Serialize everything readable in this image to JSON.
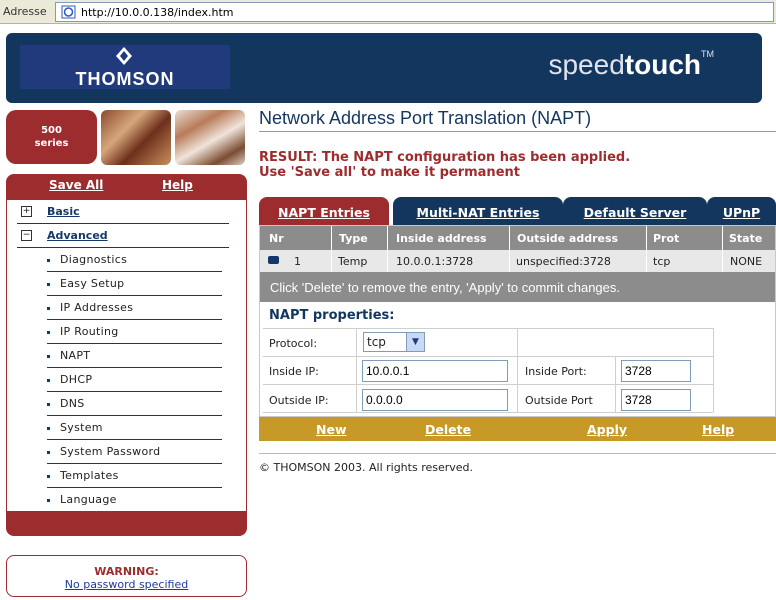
{
  "browser": {
    "address_label": "Adresse",
    "url": "http://10.0.0.138/index.htm"
  },
  "header": {
    "logo_text": "THOMSON",
    "brand_light": "speed",
    "brand_bold": "touch",
    "brand_tm": "TM"
  },
  "series": {
    "number": "500",
    "label": "series"
  },
  "sidebar": {
    "save_all": "Save All",
    "help": "Help",
    "groups": [
      {
        "label": "Basic",
        "state": "+"
      },
      {
        "label": "Advanced",
        "state": "−"
      }
    ],
    "items": [
      "Diagnostics",
      "Easy Setup",
      "IP Addresses",
      "IP Routing",
      "NAPT",
      "DHCP",
      "DNS",
      "System",
      "System Password",
      "Templates",
      "Language"
    ]
  },
  "warning": {
    "title": "WARNING:",
    "link": "No password specified"
  },
  "main": {
    "title": "Network Address Port Translation (NAPT)",
    "result_line1": "RESULT: The NAPT configuration has been applied.",
    "result_line2": "Use 'Save all' to make it permanent",
    "tabs": [
      "NAPT Entries",
      "Multi-NAT Entries",
      "Default Server",
      "UPnP"
    ],
    "table": {
      "columns": [
        "Nr",
        "Type",
        "Inside address",
        "Outside address",
        "Prot",
        "State"
      ],
      "rows": [
        {
          "nr": "1",
          "type": "Temp",
          "inside": "10.0.0.1:3728",
          "outside": "unspecified:3728",
          "prot": "tcp",
          "state": "NONE"
        }
      ]
    },
    "hint": "Click 'Delete' to remove the entry, 'Apply' to commit changes.",
    "properties": {
      "title": "NAPT properties:",
      "protocol_label": "Protocol:",
      "protocol_value": "tcp",
      "inside_ip_label": "Inside IP:",
      "inside_ip_value": "10.0.0.1",
      "outside_ip_label": "Outside IP:",
      "outside_ip_value": "0.0.0.0",
      "inside_port_label": "Inside Port:",
      "inside_port_value": "3728",
      "outside_port_label": "Outside Port",
      "outside_port_value": "3728"
    },
    "actions": [
      "New",
      "Delete",
      "Apply",
      "Help"
    ],
    "copyright": "© THOMSON 2003. All rights reserved."
  },
  "colors": {
    "navy": "#13365f",
    "maroon": "#9d2c2e",
    "gold": "#c79a28",
    "grey_header": "#8c8c8c"
  },
  "icons": [
    "ie-page-icon",
    "thomson-logo-icon",
    "dropdown-arrow-icon",
    "expand-icon",
    "collapse-icon",
    "row-status-icon"
  ]
}
